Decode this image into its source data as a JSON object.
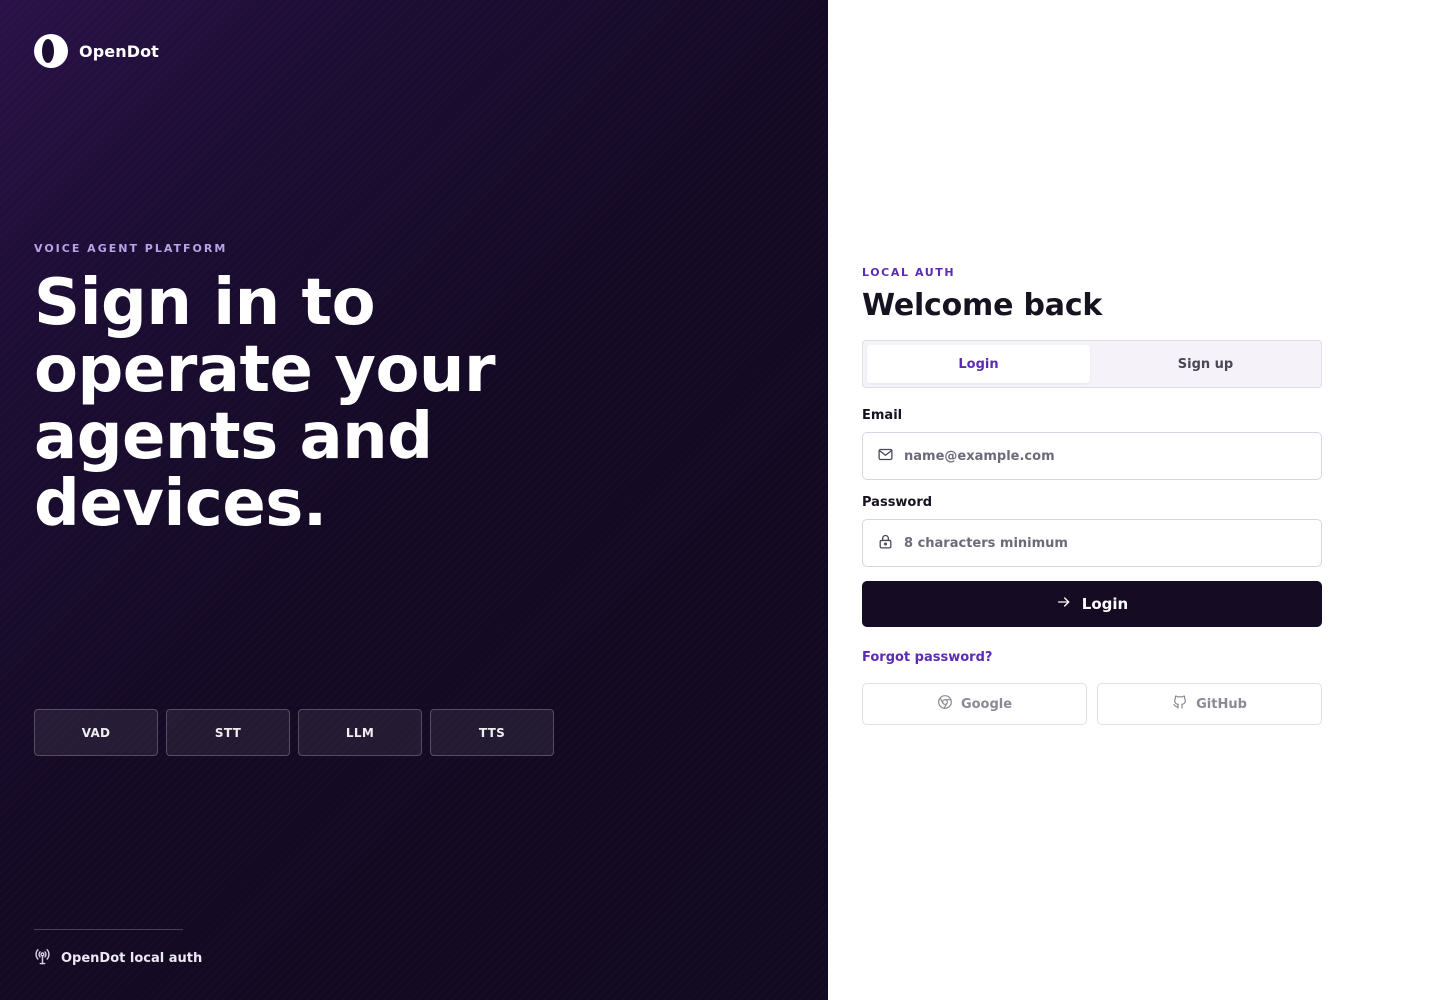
{
  "brand": {
    "name": "OpenDot"
  },
  "hero": {
    "eyebrow": "VOICE AGENT PLATFORM",
    "headline": "Sign in to operate your agents and devices.",
    "chips": [
      "VAD",
      "STT",
      "LLM",
      "TTS"
    ],
    "footer": "OpenDot local auth"
  },
  "form": {
    "eyebrow": "LOCAL AUTH",
    "title": "Welcome back",
    "tabs": [
      {
        "label": "Login",
        "active": true
      },
      {
        "label": "Sign up",
        "active": false
      }
    ],
    "email": {
      "label": "Email",
      "placeholder": "name@example.com",
      "value": ""
    },
    "password": {
      "label": "Password",
      "placeholder": "8 characters minimum",
      "value": ""
    },
    "submit_label": "Login",
    "forgot_label": "Forgot password?",
    "oauth": [
      {
        "label": "Google",
        "icon": "chrome-icon"
      },
      {
        "label": "GitHub",
        "icon": "github-icon"
      }
    ]
  },
  "colors": {
    "accent": "#5b2bb5",
    "dark": "#150b22",
    "panel_bg": "#140a24"
  }
}
